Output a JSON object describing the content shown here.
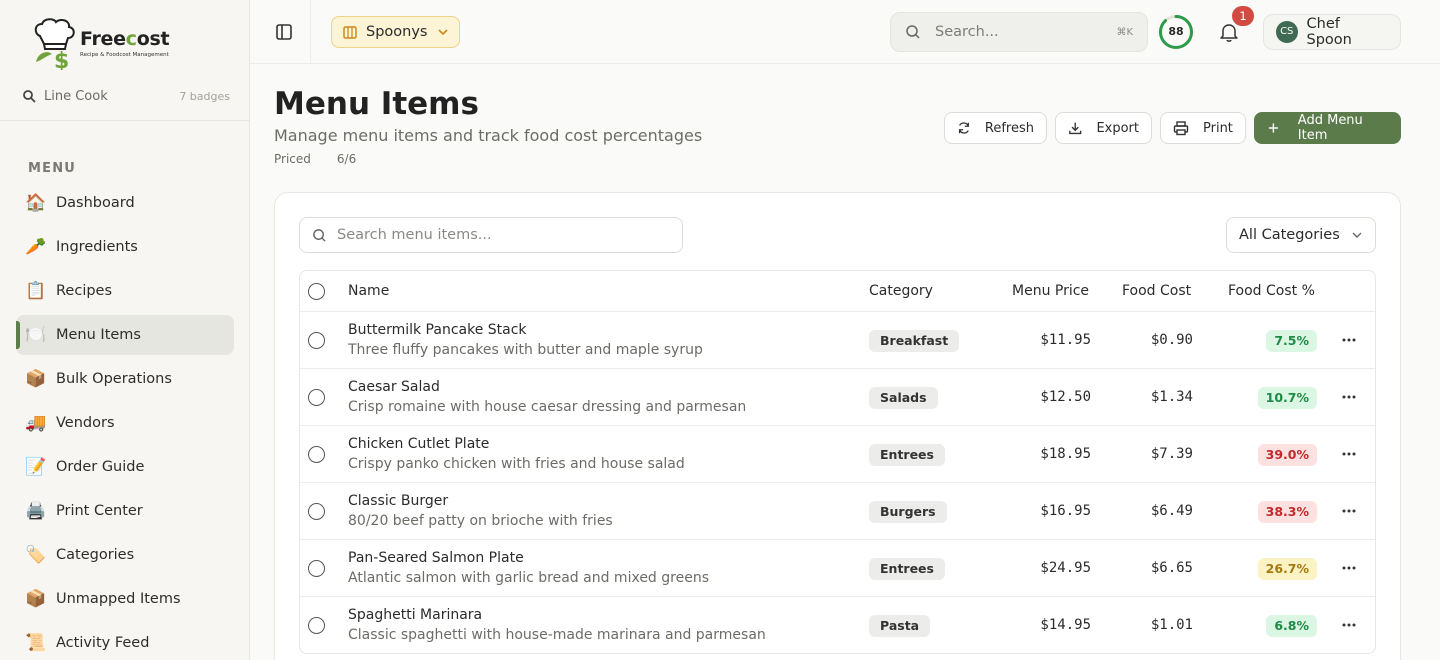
{
  "brand": {
    "name_a": "Free",
    "name_c": "c",
    "name_b": "ost",
    "tagline": "Recipe & Foodcost Management"
  },
  "role": {
    "name": "Line Cook",
    "badges": "7 badges"
  },
  "sidebar": {
    "heading": "MENU",
    "items": [
      {
        "label": "Dashboard",
        "icon": "🏠"
      },
      {
        "label": "Ingredients",
        "icon": "🥕"
      },
      {
        "label": "Recipes",
        "icon": "📋"
      },
      {
        "label": "Menu Items",
        "icon": "🍽️"
      },
      {
        "label": "Bulk Operations",
        "icon": "📦"
      },
      {
        "label": "Vendors",
        "icon": "🚚"
      },
      {
        "label": "Order Guide",
        "icon": "📝"
      },
      {
        "label": "Print Center",
        "icon": "🖨️"
      },
      {
        "label": "Categories",
        "icon": "🏷️"
      },
      {
        "label": "Unmapped Items",
        "icon": "📦"
      },
      {
        "label": "Activity Feed",
        "icon": "📜"
      }
    ]
  },
  "header": {
    "location": "Spoonys",
    "search_placeholder": "Search...",
    "search_shortcut": "⌘K",
    "score": "88",
    "score_fraction": 0.88,
    "notifications": "1",
    "user_initials": "CS",
    "user_name": "Chef Spoon"
  },
  "page": {
    "title": "Menu Items",
    "subtitle": "Manage menu items and track food cost percentages",
    "priced_label": "Priced",
    "priced_value": "6/6"
  },
  "actions": {
    "refresh": "Refresh",
    "export": "Export",
    "print": "Print",
    "add": "Add Menu Item"
  },
  "filters": {
    "search_placeholder": "Search menu items...",
    "category": "All Categories"
  },
  "table": {
    "headers": {
      "name": "Name",
      "category": "Category",
      "price": "Menu Price",
      "cost": "Food Cost",
      "pct": "Food Cost %"
    },
    "rows": [
      {
        "name": "Buttermilk Pancake Stack",
        "desc": "Three fluffy pancakes with butter and maple syrup",
        "category": "Breakfast",
        "price": "$11.95",
        "cost": "$0.90",
        "pct": "7.5%",
        "status": "good"
      },
      {
        "name": "Caesar Salad",
        "desc": "Crisp romaine with house caesar dressing and parmesan",
        "category": "Salads",
        "price": "$12.50",
        "cost": "$1.34",
        "pct": "10.7%",
        "status": "good"
      },
      {
        "name": "Chicken Cutlet Plate",
        "desc": "Crispy panko chicken with fries and house salad",
        "category": "Entrees",
        "price": "$18.95",
        "cost": "$7.39",
        "pct": "39.0%",
        "status": "bad"
      },
      {
        "name": "Classic Burger",
        "desc": "80/20 beef patty on brioche with fries",
        "category": "Burgers",
        "price": "$16.95",
        "cost": "$6.49",
        "pct": "38.3%",
        "status": "bad"
      },
      {
        "name": "Pan-Seared Salmon Plate",
        "desc": "Atlantic salmon with garlic bread and mixed greens",
        "category": "Entrees",
        "price": "$24.95",
        "cost": "$6.65",
        "pct": "26.7%",
        "status": "warn"
      },
      {
        "name": "Spaghetti Marinara",
        "desc": "Classic spaghetti with house-made marinara and parmesan",
        "category": "Pasta",
        "price": "$14.95",
        "cost": "$1.01",
        "pct": "6.8%",
        "status": "good"
      }
    ]
  },
  "colors": {
    "accent": "#5b7b4b",
    "score_ring": "#2e9a4a",
    "badge_red": "#d04c43",
    "location_bg": "#fdf4d6"
  }
}
